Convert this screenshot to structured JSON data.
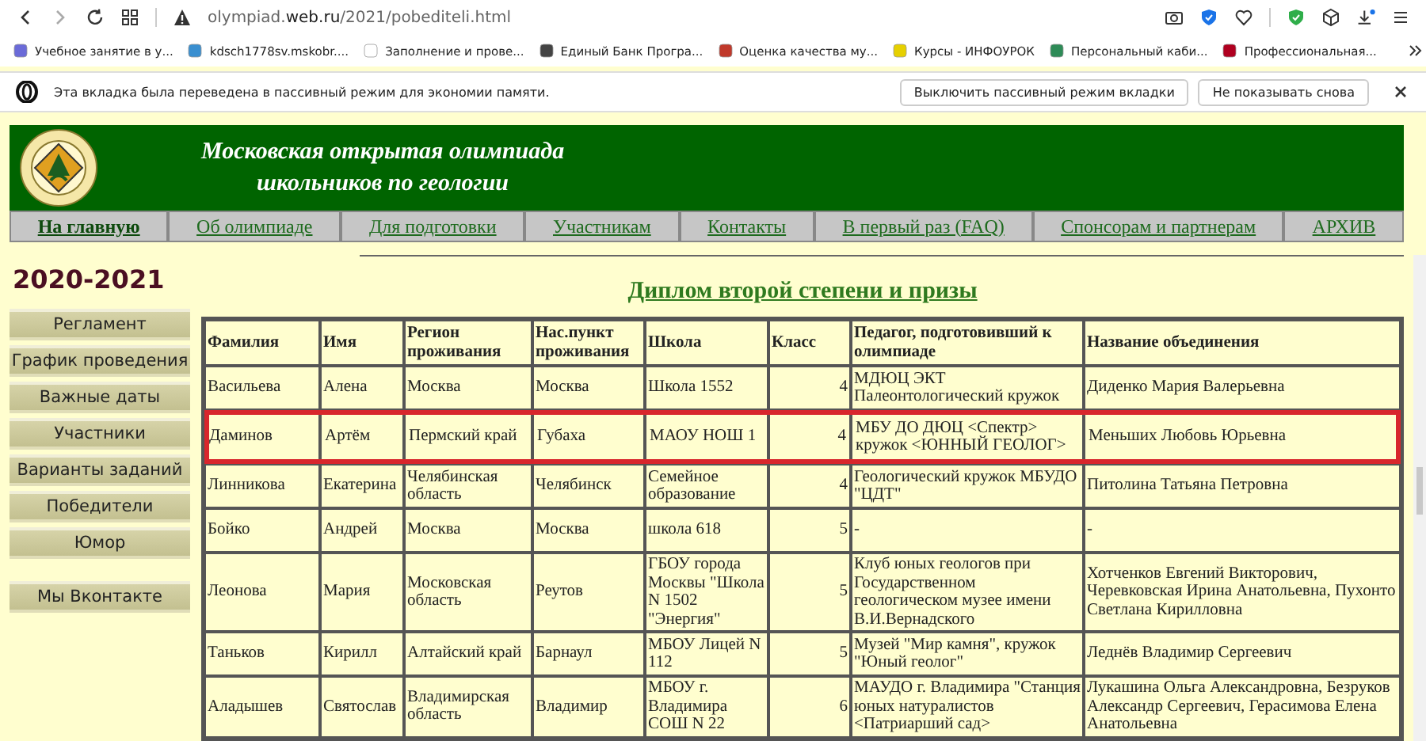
{
  "browser": {
    "url": "olympiad.**web.ru**/2021/pobediteli.html",
    "bookmarks": [
      {
        "label": "Учебное занятие в у..."
      },
      {
        "label": "kdsch1778sv.mskobr...."
      },
      {
        "label": "Заполнение и прове..."
      },
      {
        "label": "Единый Банк Програ..."
      },
      {
        "label": "Оценка качества му..."
      },
      {
        "label": "Курсы - ИНФОУРОК"
      },
      {
        "label": "Персональный каби..."
      },
      {
        "label": "Профессиональная..."
      }
    ],
    "notice": {
      "text": "Эта вкладка была переведена в пассивный режим для экономии памяти.",
      "buttons": [
        "Выключить пассивный режим вкладки",
        "Не показывать снова"
      ]
    }
  },
  "site": {
    "title_lines": [
      "Московская открытая олимпиада",
      "школьников по геологии"
    ],
    "nav": [
      {
        "label": "На главную",
        "selected": true
      },
      {
        "label": "Об олимпиаде",
        "selected": false
      },
      {
        "label": "Для подготовки",
        "selected": false
      },
      {
        "label": "Участникам",
        "selected": false
      },
      {
        "label": "Контакты",
        "selected": false
      },
      {
        "label": "В первый раз (FAQ)",
        "selected": false
      },
      {
        "label": "Спонсорам и партнерам",
        "selected": false
      },
      {
        "label": "АРХИВ",
        "selected": false
      }
    ],
    "year": "2020-2021",
    "sidebar": [
      "Регламент",
      "График проведения",
      "Важные даты",
      "Участники",
      "Варианты заданий",
      "Победители",
      "Юмор"
    ],
    "sidebar_extra": "Мы Вконтакте",
    "heading": "Диплом второй степени и призы",
    "table": {
      "columns": [
        "Фамилия",
        "Имя",
        "Регион проживания",
        "Нас.пункт проживания",
        "Школа",
        "Класс",
        "Педагог, подготовивший к олимпиаде",
        "Название объединения"
      ],
      "rows": [
        {
          "highlighted": false,
          "cells": [
            "Васильева",
            "Алена",
            "Москва",
            "Москва",
            "Школа 1552",
            "4",
            "МДЮЦ ЭКТ Палеонтологический кружок",
            "Диденко Мария Валерьевна"
          ]
        },
        {
          "highlighted": true,
          "cells": [
            "Даминов",
            "Артём",
            "Пермский край",
            "Губаха",
            "МАОУ НОШ 1",
            "4",
            "МБУ ДО ДЮЦ <Спектр> кружок <ЮННЫЙ ГЕОЛОГ>",
            "Меньших Любовь Юрьевна"
          ]
        },
        {
          "highlighted": false,
          "cells": [
            "Линникова",
            "Екатерина",
            "Челябинская область",
            "Челябинск",
            "Семейное образование",
            "4",
            "Геологический кружок МБУДО \"ЦДТ\"",
            "Питолина Татьяна Петровна"
          ]
        },
        {
          "highlighted": false,
          "cells": [
            "Бойко",
            "Андрей",
            "Москва",
            "Москва",
            "школа 618",
            "5",
            "-",
            "-"
          ]
        },
        {
          "highlighted": false,
          "cells": [
            "Леонова",
            "Мария",
            "Московская область",
            "Реутов",
            "ГБОУ города Москвы \"Школа N 1502 \"Энергия\"",
            "5",
            "Клуб юных геологов при Государственном геологическом музее имени В.И.Вернадского",
            "Хотченков Евгений Викторович, Черевковская Ирина Анатольевна, Пухонто Светлана Кирилловна"
          ]
        },
        {
          "highlighted": false,
          "cells": [
            "Таньков",
            "Кирилл",
            "Алтайский край",
            "Барнаул",
            "МБОУ Лицей N 112",
            "5",
            "Музей \"Мир камня\", кружок \"Юный геолог\"",
            "Леднёв Владимир Сергеевич"
          ]
        },
        {
          "highlighted": false,
          "cells": [
            "Аладышев",
            "Святослав",
            "Владимирская область",
            "Владимир",
            "МБОУ г. Владимира СОШ N 22",
            "6",
            "МАУДО г. Владимира \"Станция юных натуралистов <Патриарший сад>",
            "Лукашина Ольга Александровна, Безруков Александр Сергеевич, Герасимова Елена Анатольевна"
          ]
        }
      ]
    }
  }
}
